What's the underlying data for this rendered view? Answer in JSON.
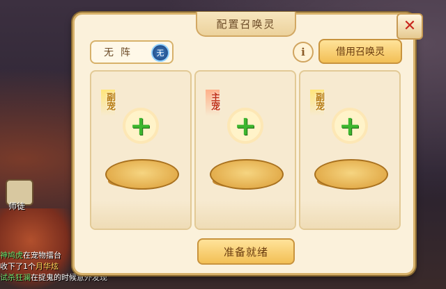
{
  "dialog": {
    "title": "配置召唤灵",
    "close_symbol": "✕",
    "formation": {
      "label": "无阵",
      "badge": "无"
    },
    "info_symbol": "i",
    "borrow_button": "借用召唤灵",
    "slots": [
      {
        "tag": "副宠",
        "plus": "+"
      },
      {
        "tag": "主宠",
        "plus": "+"
      },
      {
        "tag": "副宠",
        "plus": "+"
      }
    ],
    "ready_button": "准备就绪"
  },
  "background": {
    "avatar_label": "师徒",
    "chat_lines": [
      {
        "name": "神鸠虎",
        "text": "在宠物擂台"
      },
      {
        "name": "",
        "text": "收下了1个",
        "highlight": "月华炫"
      },
      {
        "name": "试杀狂澜",
        "text": "在捉鬼的时候意外发现"
      }
    ]
  }
}
